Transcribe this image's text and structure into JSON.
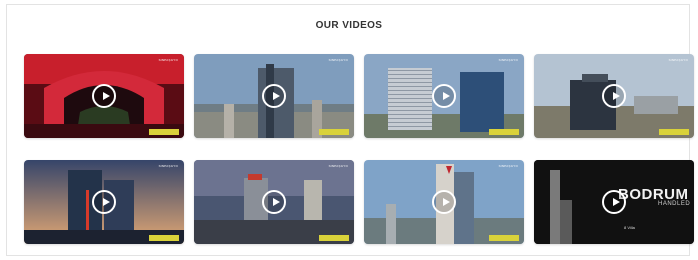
{
  "section": {
    "title": "OUR VIDEOS"
  },
  "videos": [
    {
      "brand": "SINPAŞGYO"
    },
    {
      "brand": "SINPAŞGYO"
    },
    {
      "brand": "SINPAŞGYO"
    },
    {
      "brand": "SINPAŞGYO"
    },
    {
      "brand": "SINPAŞGYO"
    },
    {
      "brand": "SINPAŞGYO"
    },
    {
      "brand": "SINPAŞGYO"
    },
    {
      "brand": "",
      "title": "BODRUM",
      "subtitle": "HANDLED",
      "note": "8 Villa"
    }
  ],
  "colors": {
    "tag_yellow": "#d9d23a",
    "card_dark": "#111111"
  }
}
